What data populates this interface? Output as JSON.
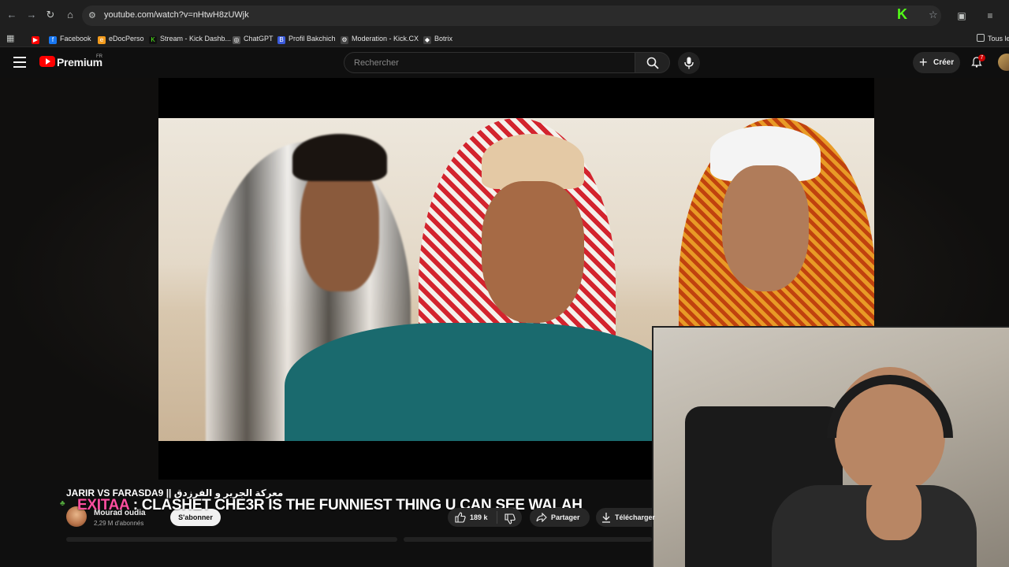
{
  "browser": {
    "url": "youtube.com/watch?v=nHtwH8zUWjk",
    "bookmarks": [
      "Facebook",
      "eDocPerso",
      "Stream - Kick Dashb...",
      "ChatGPT",
      "Profil Bakchich",
      "Moderation - Kick.CX",
      "Botrix"
    ],
    "all_bookmarks_label": "Tous le",
    "colors": {
      "kick_green": "#53fc18",
      "chrome_bg": "#1f1f1f"
    }
  },
  "youtube": {
    "brand": "Premium",
    "region": "FR",
    "search_placeholder": "Rechercher",
    "create_label": "Créer",
    "notification_count": "7",
    "colors": {
      "brand_red": "#ff0000",
      "bg": "#0f0f0f"
    }
  },
  "video": {
    "subtitle_arabic": "JARIR VS FARASDA9 || معركة الجرير و الفرزدق",
    "title_highlight": "EXITAA",
    "title_rest": " : CLASHET CHE3R IS THE FUNNIEST THING U CAN SEE WALAH",
    "channel_name": "Mourad oudia",
    "subscribers": "2,29 M d'abonnés",
    "subscribe_label": "S'abonner",
    "likes": "189 k",
    "share_label": "Partager",
    "download_label": "Télécharger"
  }
}
